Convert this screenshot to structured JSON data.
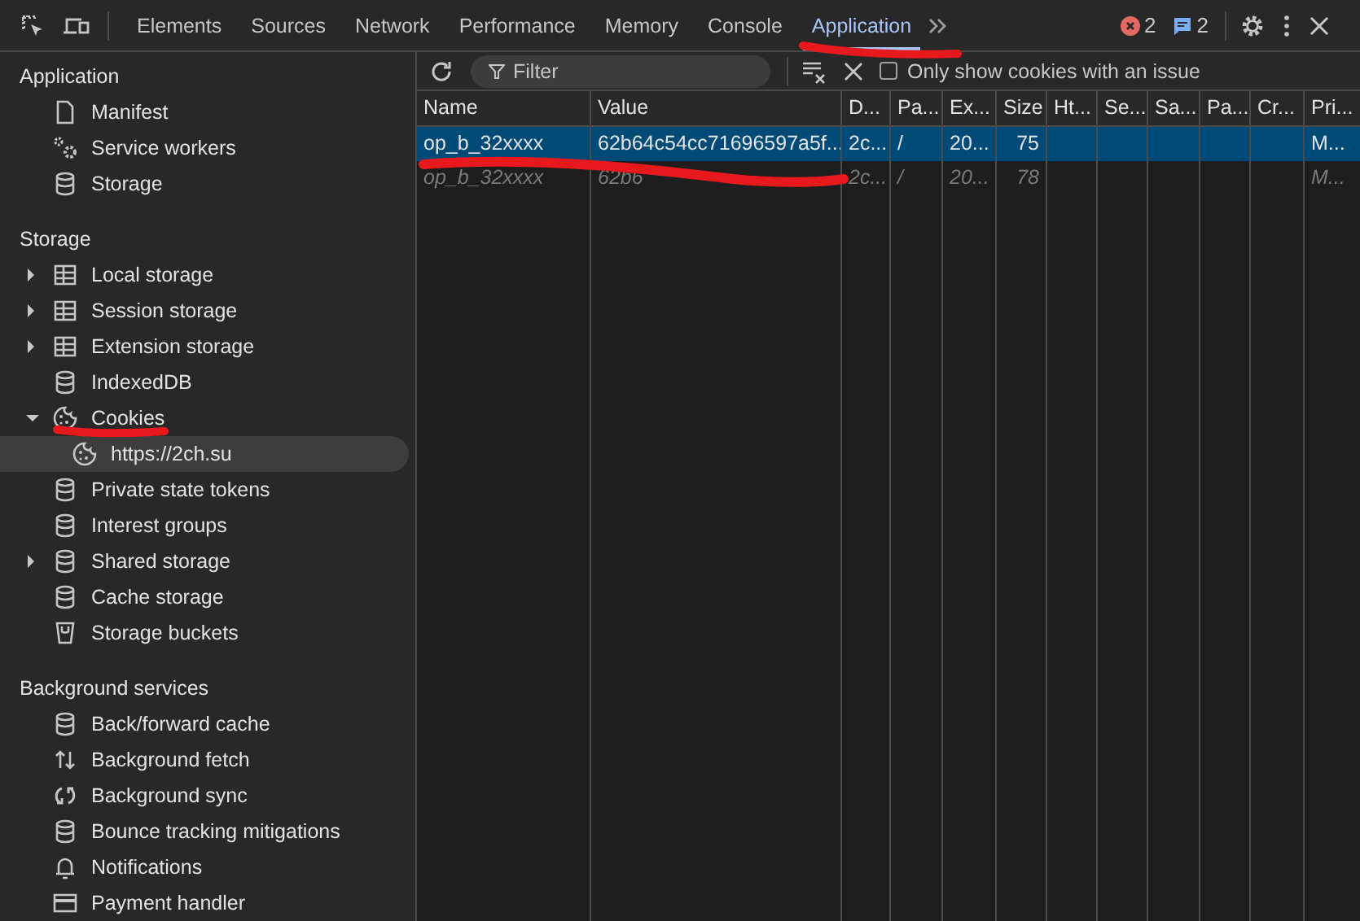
{
  "toolbar": {
    "tabs": [
      {
        "label": "Elements",
        "selected": false
      },
      {
        "label": "Sources",
        "selected": false
      },
      {
        "label": "Network",
        "selected": false
      },
      {
        "label": "Performance",
        "selected": false
      },
      {
        "label": "Memory",
        "selected": false
      },
      {
        "label": "Console",
        "selected": false
      },
      {
        "label": "Application",
        "selected": true
      }
    ],
    "error_count": "2",
    "message_count": "2"
  },
  "sidebar": {
    "sections": [
      {
        "title": "Application",
        "items": [
          {
            "label": "Manifest",
            "kind": "file",
            "selected": false
          },
          {
            "label": "Service workers",
            "kind": "gears",
            "selected": false
          },
          {
            "label": "Storage",
            "kind": "database",
            "selected": false
          }
        ]
      },
      {
        "title": "Storage",
        "items": [
          {
            "label": "Local storage",
            "kind": "table",
            "expanded": false,
            "selected": false
          },
          {
            "label": "Session storage",
            "kind": "table",
            "expanded": false,
            "selected": false
          },
          {
            "label": "Extension storage",
            "kind": "table",
            "expanded": false,
            "selected": false
          },
          {
            "label": "IndexedDB",
            "kind": "database",
            "selected": false
          },
          {
            "label": "Cookies",
            "kind": "cookie",
            "expanded": true,
            "selected": false,
            "children": [
              {
                "label": "https://2ch.su",
                "kind": "cookie",
                "selected": true
              }
            ]
          },
          {
            "label": "Private state tokens",
            "kind": "database",
            "selected": false
          },
          {
            "label": "Interest groups",
            "kind": "database",
            "selected": false
          },
          {
            "label": "Shared storage",
            "kind": "database",
            "expanded": false,
            "selected": false
          },
          {
            "label": "Cache storage",
            "kind": "database",
            "selected": false
          },
          {
            "label": "Storage buckets",
            "kind": "bucket",
            "selected": false
          }
        ]
      },
      {
        "title": "Background services",
        "items": [
          {
            "label": "Back/forward cache",
            "kind": "database",
            "selected": false
          },
          {
            "label": "Background fetch",
            "kind": "updown",
            "selected": false
          },
          {
            "label": "Background sync",
            "kind": "sync",
            "selected": false
          },
          {
            "label": "Bounce tracking mitigations",
            "kind": "database",
            "selected": false
          },
          {
            "label": "Notifications",
            "kind": "bell",
            "selected": false
          },
          {
            "label": "Payment handler",
            "kind": "card",
            "selected": false
          }
        ]
      }
    ]
  },
  "cookie_toolbar": {
    "filter": {
      "placeholder": "Filter"
    },
    "only_issues": {
      "label": "Only show cookies with an issue",
      "checked": false
    }
  },
  "table": {
    "columns": [
      {
        "label": "Name"
      },
      {
        "label": "Value"
      },
      {
        "label": "D..."
      },
      {
        "label": "Pa..."
      },
      {
        "label": "Ex..."
      },
      {
        "label": "Size"
      },
      {
        "label": "Ht..."
      },
      {
        "label": "Se..."
      },
      {
        "label": "Sa..."
      },
      {
        "label": "Pa..."
      },
      {
        "label": "Cr..."
      },
      {
        "label": "Pri..."
      }
    ],
    "rows": [
      {
        "selected": true,
        "dimmed": false,
        "cells": [
          "op_b_32xxxx",
          "62b64c54cc71696597a5f...",
          "2c...",
          "/",
          "20...",
          "75",
          "",
          "",
          "",
          "",
          "",
          "M..."
        ]
      },
      {
        "selected": false,
        "dimmed": true,
        "cells": [
          "op_b_32xxxx",
          "62b6",
          "2c...",
          "/",
          "20...",
          "78",
          "",
          "",
          "",
          "",
          "",
          "M..."
        ]
      }
    ]
  }
}
